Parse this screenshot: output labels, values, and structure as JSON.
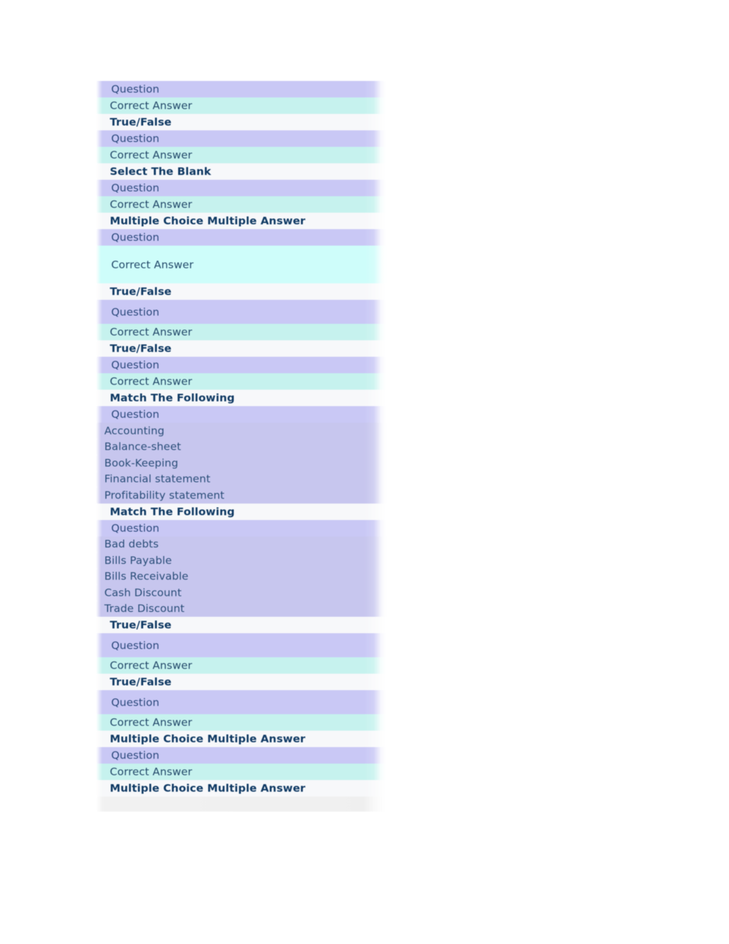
{
  "document": {
    "type": "question-bank-listing",
    "label_question": "Question",
    "label_correct_answer": "Correct Answer",
    "colors": {
      "question_band": "#c9c8f5",
      "answer_band": "#c6f2ee",
      "answer_band_bright": "#cefdfa",
      "heading_band": "#f7f8fa",
      "match_band": "#c7c6ee",
      "heading_text": "#103a64",
      "body_text": "#2d4a7d",
      "page_background": "#ffffff"
    },
    "rows": [
      {
        "kind": "question",
        "text": "Question"
      },
      {
        "kind": "answer",
        "text": "Correct Answer"
      },
      {
        "kind": "heading",
        "text": "True/False"
      },
      {
        "kind": "question",
        "text": "Question"
      },
      {
        "kind": "answer",
        "text": "Correct Answer"
      },
      {
        "kind": "heading",
        "text": "Select The Blank"
      },
      {
        "kind": "question",
        "text": "Question"
      },
      {
        "kind": "answer",
        "text": "Correct Answer"
      },
      {
        "kind": "heading",
        "text": "Multiple Choice Multiple Answer"
      },
      {
        "kind": "question",
        "text": "Question"
      },
      {
        "kind": "answer-bright",
        "text": "Correct Answer"
      },
      {
        "kind": "heading",
        "text": "True/False"
      },
      {
        "kind": "question-tall",
        "text": "Question"
      },
      {
        "kind": "answer",
        "text": "Correct Answer"
      },
      {
        "kind": "heading",
        "text": "True/False"
      },
      {
        "kind": "question",
        "text": "Question"
      },
      {
        "kind": "answer",
        "text": "Correct Answer"
      },
      {
        "kind": "heading",
        "text": "Match The Following"
      },
      {
        "kind": "question",
        "text": "Question"
      },
      {
        "kind": "match",
        "text": "Accounting"
      },
      {
        "kind": "match",
        "text": "Balance-sheet"
      },
      {
        "kind": "match",
        "text": "Book-Keeping"
      },
      {
        "kind": "match",
        "text": "Financial statement"
      },
      {
        "kind": "match",
        "text": "Profitability statement"
      },
      {
        "kind": "heading",
        "text": "Match The Following"
      },
      {
        "kind": "question",
        "text": "Question"
      },
      {
        "kind": "match",
        "text": "Bad debts"
      },
      {
        "kind": "match",
        "text": "Bills Payable"
      },
      {
        "kind": "match",
        "text": "Bills Receivable"
      },
      {
        "kind": "match",
        "text": "Cash Discount"
      },
      {
        "kind": "match",
        "text": "Trade Discount"
      },
      {
        "kind": "heading",
        "text": "True/False"
      },
      {
        "kind": "question-tall",
        "text": "Question"
      },
      {
        "kind": "answer",
        "text": "Correct Answer"
      },
      {
        "kind": "heading",
        "text": "True/False"
      },
      {
        "kind": "question-tall",
        "text": "Question"
      },
      {
        "kind": "answer",
        "text": "Correct Answer"
      },
      {
        "kind": "heading",
        "text": "Multiple Choice Multiple Answer"
      },
      {
        "kind": "question",
        "text": "Question"
      },
      {
        "kind": "answer",
        "text": "Correct Answer"
      },
      {
        "kind": "heading",
        "text": "Multiple Choice Multiple Answer"
      },
      {
        "kind": "tail",
        "text": ""
      }
    ]
  }
}
